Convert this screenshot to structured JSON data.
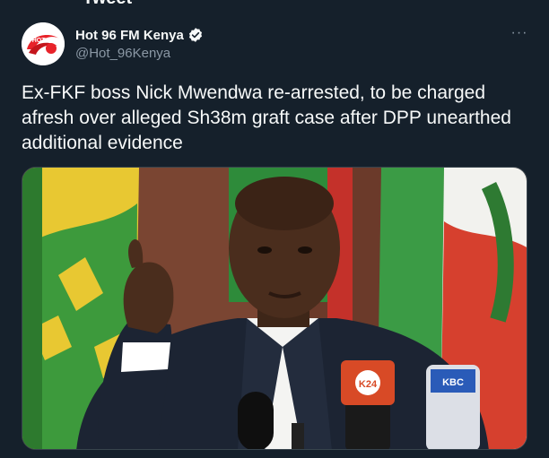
{
  "header": {
    "title": "Tweet"
  },
  "tweet": {
    "display_name": "Hot 96 FM Kenya",
    "handle": "@Hot_96Kenya",
    "verified": true,
    "text": "Ex-FKF boss Nick Mwendwa re-arrested, to be charged afresh over alleged Sh38m graft case after DPP unearthed additional evidence",
    "more_label": "···",
    "avatar_text": "HOT 96"
  },
  "media": {
    "mic_label": "K24",
    "mic2_label": "KBC"
  },
  "colors": {
    "background": "#15202b",
    "text": "#f7f9f9",
    "secondary": "#8b98a5",
    "verified": "#1d9bf0",
    "avatar_red": "#e8232a"
  }
}
